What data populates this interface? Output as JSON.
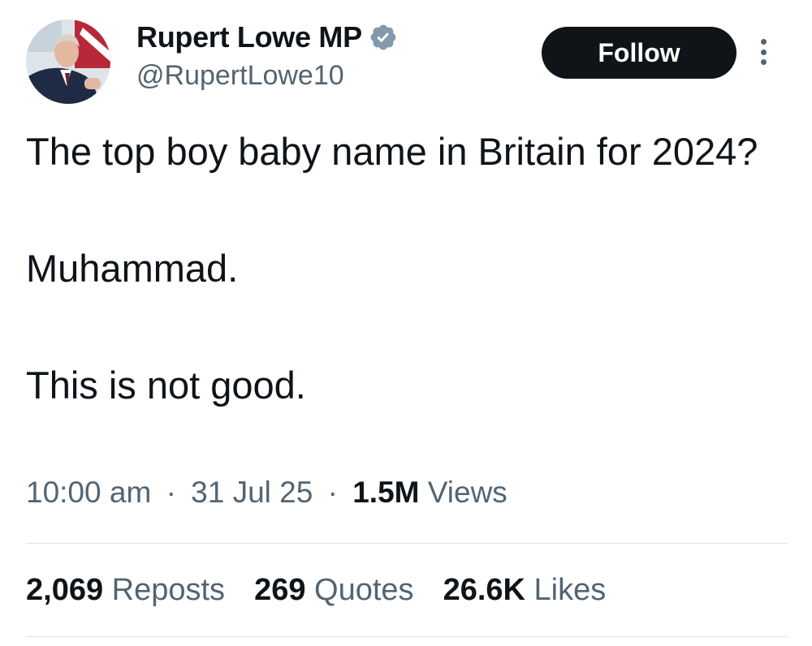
{
  "author": {
    "display_name": "Rupert Lowe MP",
    "handle": "@RupertLowe10",
    "verified_icon": "verified-badge-icon",
    "verified_color": "#829aab"
  },
  "actions": {
    "follow_label": "Follow",
    "more_icon": "more-vertical-icon"
  },
  "tweet": {
    "lines": [
      "The top boy baby name in Britain for 2024?",
      "Muhammad.",
      "This is not good."
    ]
  },
  "meta": {
    "time": "10:00 am",
    "separator": "·",
    "date": "31 Jul 25",
    "views_count": "1.5M",
    "views_label": "Views"
  },
  "stats": [
    {
      "count": "2,069",
      "label": "Reposts"
    },
    {
      "count": "269",
      "label": "Quotes"
    },
    {
      "count": "26.6K",
      "label": "Likes"
    }
  ],
  "colors": {
    "text_primary": "#0f1419",
    "text_secondary": "#536471",
    "follow_bg": "#0f1419",
    "divider": "#dfe3e6"
  }
}
